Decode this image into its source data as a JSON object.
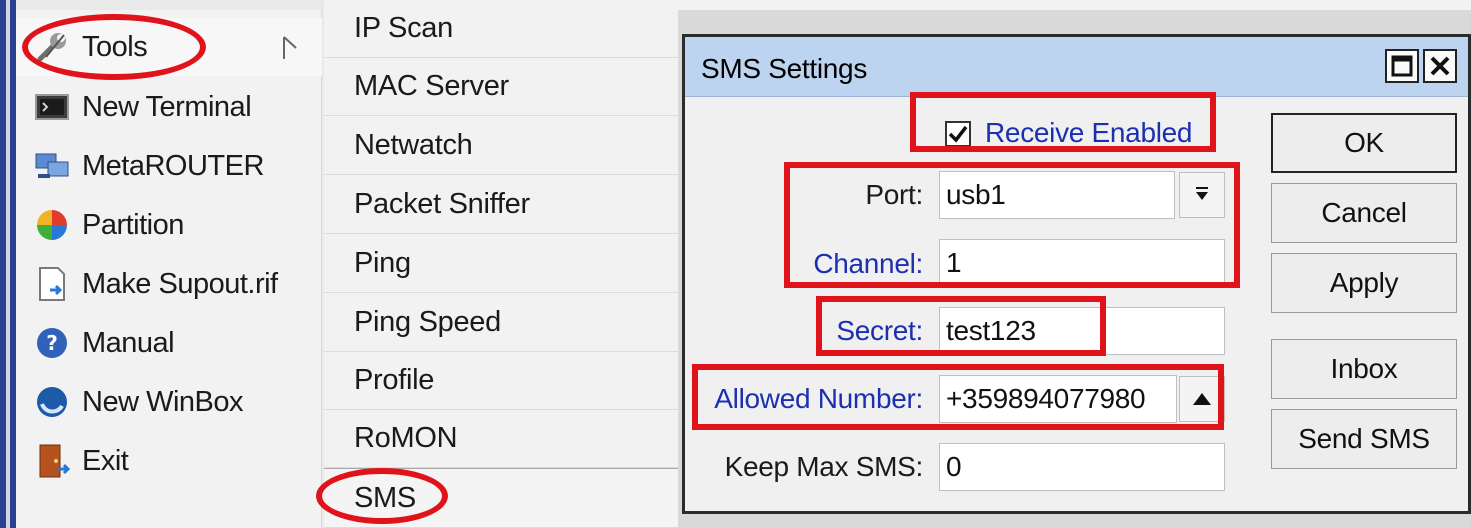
{
  "left_menu": {
    "items": [
      {
        "label": "Tools",
        "icon": "wrench-icon"
      },
      {
        "label": "New Terminal",
        "icon": "terminal-icon"
      },
      {
        "label": "MetaROUTER",
        "icon": "metarouter-icon"
      },
      {
        "label": "Partition",
        "icon": "partition-icon"
      },
      {
        "label": "Make Supout.rif",
        "icon": "document-icon"
      },
      {
        "label": "Manual",
        "icon": "help-icon"
      },
      {
        "label": "New WinBox",
        "icon": "winbox-icon"
      },
      {
        "label": "Exit",
        "icon": "exit-door-icon"
      }
    ]
  },
  "submenu": {
    "items": [
      {
        "label": "IP Scan"
      },
      {
        "label": "MAC Server"
      },
      {
        "label": "Netwatch"
      },
      {
        "label": "Packet Sniffer"
      },
      {
        "label": "Ping"
      },
      {
        "label": "Ping Speed"
      },
      {
        "label": "Profile"
      },
      {
        "label": "RoMON"
      },
      {
        "label": "SMS"
      }
    ]
  },
  "dialog": {
    "title": "SMS Settings",
    "receive_enabled": {
      "label": "Receive Enabled",
      "checked": true
    },
    "port": {
      "label": "Port:",
      "value": "usb1"
    },
    "channel": {
      "label": "Channel:",
      "value": "1"
    },
    "secret": {
      "label": "Secret:",
      "value": "test123"
    },
    "allowed_number": {
      "label": "Allowed Number:",
      "value": "+359894077980"
    },
    "keep_max_sms": {
      "label": "Keep Max SMS:",
      "value": "0"
    },
    "buttons": {
      "ok": "OK",
      "cancel": "Cancel",
      "apply": "Apply",
      "inbox": "Inbox",
      "send_sms": "Send SMS"
    }
  },
  "colors": {
    "highlight": "#e0131b",
    "link_label": "#1c2fb0",
    "titlebar": "#bcd4ef"
  }
}
